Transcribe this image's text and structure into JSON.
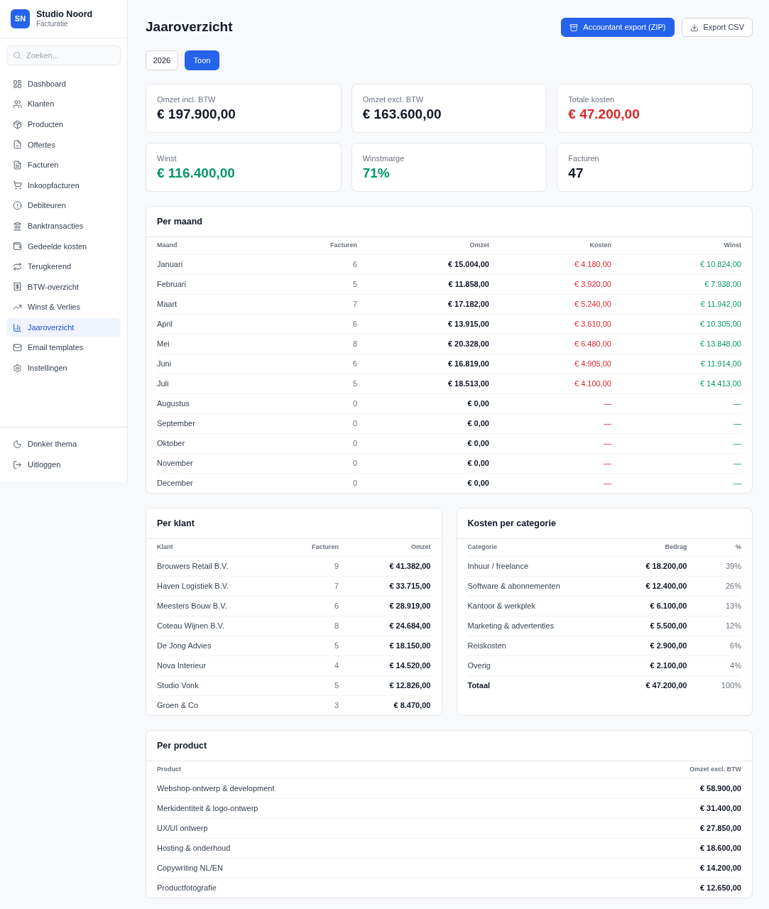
{
  "sidebar": {
    "brand": {
      "initials": "SN",
      "name": "Studio Noord",
      "subtitle": "Facturatie"
    },
    "search": {
      "placeholder": "Zoeken..."
    },
    "items": [
      {
        "label": "Dashboard",
        "selected": false
      },
      {
        "label": "Klanten",
        "selected": false
      },
      {
        "label": "Producten",
        "selected": false
      },
      {
        "label": "Offertes",
        "selected": false
      },
      {
        "label": "Facturen",
        "selected": false
      },
      {
        "label": "Inkoopfacturen",
        "selected": false
      },
      {
        "label": "Debiteuren",
        "selected": false
      },
      {
        "label": "Banktransacties",
        "selected": false
      },
      {
        "label": "Gedeelde kosten",
        "selected": false
      },
      {
        "label": "Terugkerend",
        "selected": false
      },
      {
        "label": "BTW-overzicht",
        "selected": false
      },
      {
        "label": "Winst & Verlies",
        "selected": false
      },
      {
        "label": "Jaaroverzicht",
        "selected": true
      },
      {
        "label": "Email templates",
        "selected": false
      },
      {
        "label": "Instellingen",
        "selected": false
      }
    ],
    "footer_items": [
      {
        "label": "Donker thema"
      },
      {
        "label": "Uitloggen"
      }
    ]
  },
  "header": {
    "title": "Jaaroverzicht",
    "buttons": [
      {
        "label": "Accountant export (ZIP)",
        "kind": "primary"
      },
      {
        "label": "Export CSV",
        "kind": "secondary"
      }
    ]
  },
  "year_filter": {
    "value": "2026",
    "button": "Toon"
  },
  "stats": [
    {
      "label": "Omzet incl. BTW",
      "value": "€ 197.900,00",
      "color": "#111827"
    },
    {
      "label": "Omzet excl. BTW",
      "value": "€ 163.600,00",
      "color": "#111827"
    },
    {
      "label": "Totale kosten",
      "value": "€ 47.200,00",
      "color": "#dc2626"
    },
    {
      "label": "Winst",
      "value": "€ 116.400,00",
      "color": "#059669"
    },
    {
      "label": "Winstmarge",
      "value": "71%",
      "color": "#059669"
    },
    {
      "label": "Facturen",
      "value": "47",
      "color": "#111827"
    }
  ],
  "per_month": {
    "title": "Per maand",
    "columns": [
      "Maand",
      "Facturen",
      "Omzet",
      "Kosten",
      "Winst"
    ],
    "rows": [
      [
        "Januari",
        "6",
        "€ 15.004,00",
        "€ 4.180,00",
        "€ 10.824,00"
      ],
      [
        "Februari",
        "5",
        "€ 11.858,00",
        "€ 3.920,00",
        "€ 7.938,00"
      ],
      [
        "Maart",
        "7",
        "€ 17.182,00",
        "€ 5.240,00",
        "€ 11.942,00"
      ],
      [
        "April",
        "6",
        "€ 13.915,00",
        "€ 3.610,00",
        "€ 10.305,00"
      ],
      [
        "Mei",
        "8",
        "€ 20.328,00",
        "€ 6.480,00",
        "€ 13.848,00"
      ],
      [
        "Juni",
        "6",
        "€ 16.819,00",
        "€ 4.905,00",
        "€ 11.914,00"
      ],
      [
        "Juli",
        "5",
        "€ 18.513,00",
        "€ 4.100,00",
        "€ 14.413,00"
      ],
      [
        "Augustus",
        "0",
        "€ 0,00",
        "—",
        "—"
      ],
      [
        "September",
        "0",
        "€ 0,00",
        "—",
        "—"
      ],
      [
        "Oktober",
        "0",
        "€ 0,00",
        "—",
        "—"
      ],
      [
        "November",
        "0",
        "€ 0,00",
        "—",
        "—"
      ],
      [
        "December",
        "0",
        "€ 0,00",
        "—",
        "—"
      ]
    ]
  },
  "per_client": {
    "title": "Per klant",
    "columns": [
      "Klant",
      "Facturen",
      "Omzet"
    ],
    "rows": [
      [
        "Brouwers Retail B.V.",
        "9",
        "€ 41.382,00"
      ],
      [
        "Haven Logistiek B.V.",
        "7",
        "€ 33.715,00"
      ],
      [
        "Meesters Bouw B.V.",
        "6",
        "€ 28.919,00"
      ],
      [
        "Coteau Wijnen B.V.",
        "8",
        "€ 24.684,00"
      ],
      [
        "De Jong Advies",
        "5",
        "€ 18.150,00"
      ],
      [
        "Nova Interieur",
        "4",
        "€ 14.520,00"
      ],
      [
        "Studio Vonk",
        "5",
        "€ 12.826,00"
      ],
      [
        "Groen & Co",
        "3",
        "€ 8.470,00"
      ]
    ]
  },
  "costs_per_category": {
    "title": "Kosten per categorie",
    "columns": [
      "Categorie",
      "Bedrag",
      "%"
    ],
    "rows": [
      [
        "Inhuur / freelance",
        "€ 18.200,00",
        "39%"
      ],
      [
        "Software & abonnementen",
        "€ 12.400,00",
        "26%"
      ],
      [
        "Kantoor & werkplek",
        "€ 6.100,00",
        "13%"
      ],
      [
        "Marketing & advertenties",
        "€ 5.500,00",
        "12%"
      ],
      [
        "Reiskosten",
        "€ 2.900,00",
        "6%"
      ],
      [
        "Overig",
        "€ 2.100,00",
        "4%"
      ]
    ],
    "total": [
      "Totaal",
      "€ 47.200,00",
      "100%"
    ]
  },
  "per_product": {
    "title": "Per product",
    "columns": [
      "Product",
      "Omzet excl. BTW"
    ],
    "rows": [
      [
        "Webshop-ontwerp & development",
        "€ 58.900,00"
      ],
      [
        "Merkidentiteit & logo-ontwerp",
        "€ 31.400,00"
      ],
      [
        "UX/UI ontwerp",
        "€ 27.850,00"
      ],
      [
        "Hosting & onderhoud",
        "€ 18.600,00"
      ],
      [
        "Copywriting NL/EN",
        "€ 14.200,00"
      ],
      [
        "Productfotografie",
        "€ 12.650,00"
      ]
    ]
  }
}
